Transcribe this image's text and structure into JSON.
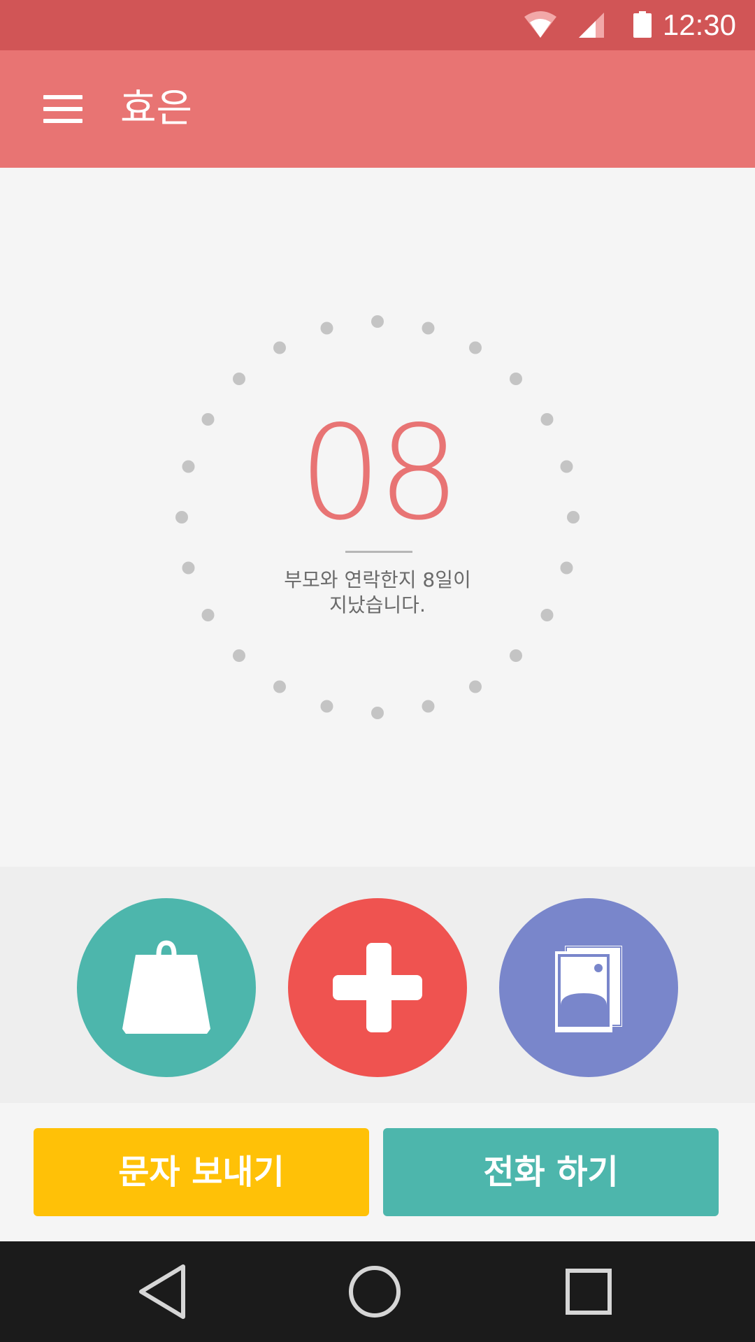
{
  "status_bar": {
    "time": "12:30",
    "icons": [
      "wifi-icon",
      "signal-icon",
      "battery-icon"
    ]
  },
  "app_bar": {
    "title": "효은",
    "menu_icon": "menu-icon"
  },
  "counter": {
    "days": "08",
    "caption_line1": "부모와 연락한지 8일이",
    "caption_line2": "지났습니다."
  },
  "actions": [
    {
      "name": "gift-button",
      "icon": "shopping-bag-icon",
      "color": "#4db6ac"
    },
    {
      "name": "health-button",
      "icon": "medical-cross-icon",
      "color": "#ef5350"
    },
    {
      "name": "album-button",
      "icon": "photo-album-icon",
      "color": "#7986cb"
    }
  ],
  "buttons": {
    "message_label": "문자 보내기",
    "call_label": "전화 하기"
  },
  "nav_bar": {
    "icons": [
      "back-icon",
      "home-icon",
      "recents-icon"
    ]
  },
  "colors": {
    "status_bar": "#d15556",
    "app_bar": "#e87473",
    "accent": "#e87474",
    "message_button": "#ffc107",
    "call_button": "#4db6ac",
    "nav_bar": "#1b1b1b"
  }
}
